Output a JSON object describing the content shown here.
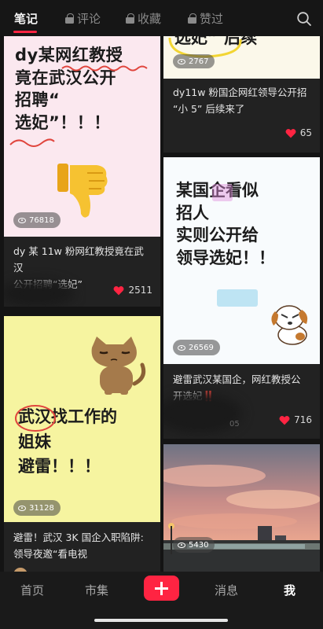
{
  "tabs": [
    {
      "label": "笔记",
      "locked": false
    },
    {
      "label": "评论",
      "locked": true
    },
    {
      "label": "收藏",
      "locked": true
    },
    {
      "label": "赞过",
      "locked": true
    }
  ],
  "search": {
    "icon": "search-icon"
  },
  "cards": {
    "c1": {
      "cover_lines": [
        "dy某网红教授",
        "竟在武汉公开",
        "招聘“",
        "选妃”！！！"
      ],
      "views": "76818",
      "title_lines": [
        "dy 某 11w 粉网红教授竟在武汉",
        "公开招聘“选妃”"
      ],
      "likes": "2511"
    },
    "c2": {
      "cover_lines": [
        "选妃” 后续"
      ],
      "views": "2767",
      "title_lines": [
        "dy11w 粉国企网红领导公开招",
        "“小 5” 后续来了"
      ],
      "likes": "65"
    },
    "c3": {
      "cover_lines": [
        "某国企看似",
        "招人",
        "实则公开给",
        "领导选妃！！"
      ],
      "views": "26569",
      "title_lines": [
        "避雷武汉某国企，网红教授公",
        "开选妃‼️"
      ],
      "likes": "716",
      "date_fragment": "05"
    },
    "c4": {
      "cover_lines": [
        "武汉找工作的",
        "姐妹",
        "避雷！！！"
      ],
      "views": "31128",
      "title_lines": [
        "避雷！武汉 3K 国企入职陷阱:",
        "领导夜邀“看电视"
      ]
    },
    "c5": {
      "views": "5430"
    }
  },
  "bottom_nav": {
    "home": "首页",
    "market": "市集",
    "messages": "消息",
    "me": "我"
  },
  "colors": {
    "accent": "#ff2442",
    "background": "#141414"
  }
}
